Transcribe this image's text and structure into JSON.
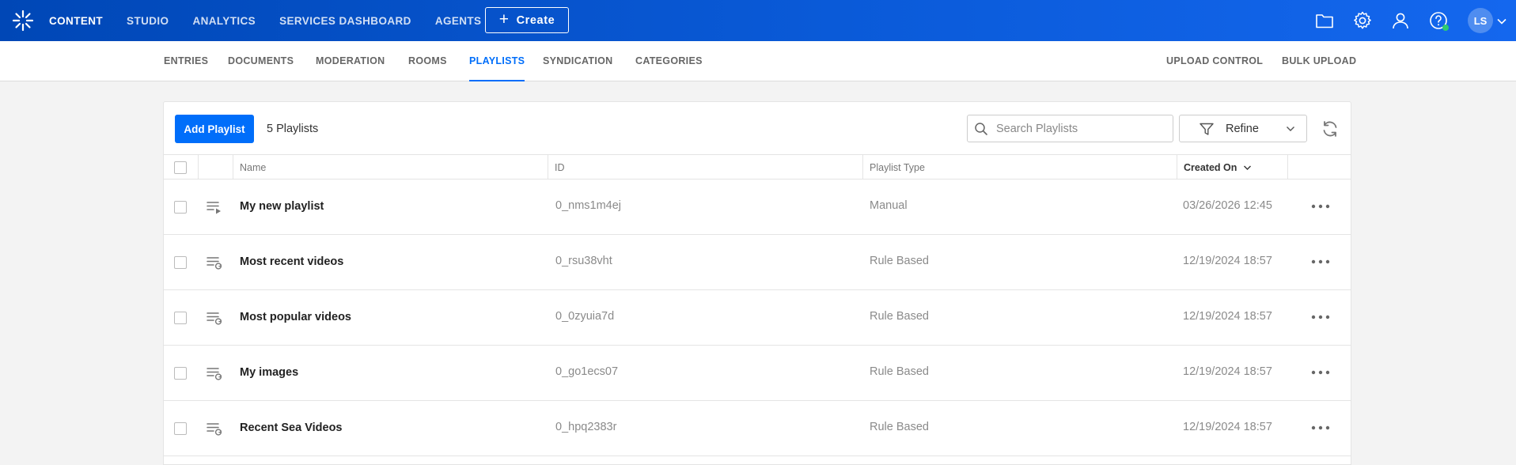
{
  "topnav": {
    "items": [
      {
        "label": "CONTENT",
        "active": true
      },
      {
        "label": "STUDIO",
        "active": false
      },
      {
        "label": "ANALYTICS",
        "active": false
      },
      {
        "label": "SERVICES DASHBOARD",
        "active": false
      },
      {
        "label": "AGENTS",
        "active": false
      }
    ],
    "create_label": "Create",
    "icons": [
      "folder-icon",
      "gear-icon",
      "user-icon",
      "help-icon"
    ],
    "avatar_initials": "LS",
    "accent": "#006efa",
    "status_dot_color": "#2ecc71"
  },
  "subnav": {
    "items": [
      {
        "label": "ENTRIES",
        "active": false
      },
      {
        "label": "DOCUMENTS",
        "active": false
      },
      {
        "label": "MODERATION",
        "active": false
      },
      {
        "label": "ROOMS",
        "active": false
      },
      {
        "label": "PLAYLISTS",
        "active": true
      },
      {
        "label": "SYNDICATION",
        "active": false
      },
      {
        "label": "CATEGORIES",
        "active": false
      }
    ],
    "right_items": [
      "UPLOAD CONTROL",
      "BULK UPLOAD"
    ]
  },
  "toolbar": {
    "add_label": "Add Playlist",
    "count_label": "5 Playlists",
    "search_placeholder": "Search Playlists",
    "refine_label": "Refine"
  },
  "table": {
    "columns": [
      "Name",
      "ID",
      "Playlist Type",
      "Created On"
    ],
    "sorted_column": "Created On",
    "sort_direction": "descending",
    "rows": [
      {
        "name": "My new playlist",
        "id": "0_nms1m4ej",
        "type": "Manual",
        "created": "03/26/2026 12:45",
        "icon": "manual-playlist-icon"
      },
      {
        "name": "Most recent videos",
        "id": "0_rsu38vht",
        "type": "Rule Based",
        "created": "12/19/2024 18:57",
        "icon": "rule-based-playlist-icon"
      },
      {
        "name": "Most popular videos",
        "id": "0_0zyuia7d",
        "type": "Rule Based",
        "created": "12/19/2024 18:57",
        "icon": "rule-based-playlist-icon"
      },
      {
        "name": "My images",
        "id": "0_go1ecs07",
        "type": "Rule Based",
        "created": "12/19/2024 18:57",
        "icon": "rule-based-playlist-icon"
      },
      {
        "name": "Recent Sea Videos",
        "id": "0_hpq2383r",
        "type": "Rule Based",
        "created": "12/19/2024 18:57",
        "icon": "rule-based-playlist-icon"
      }
    ]
  }
}
